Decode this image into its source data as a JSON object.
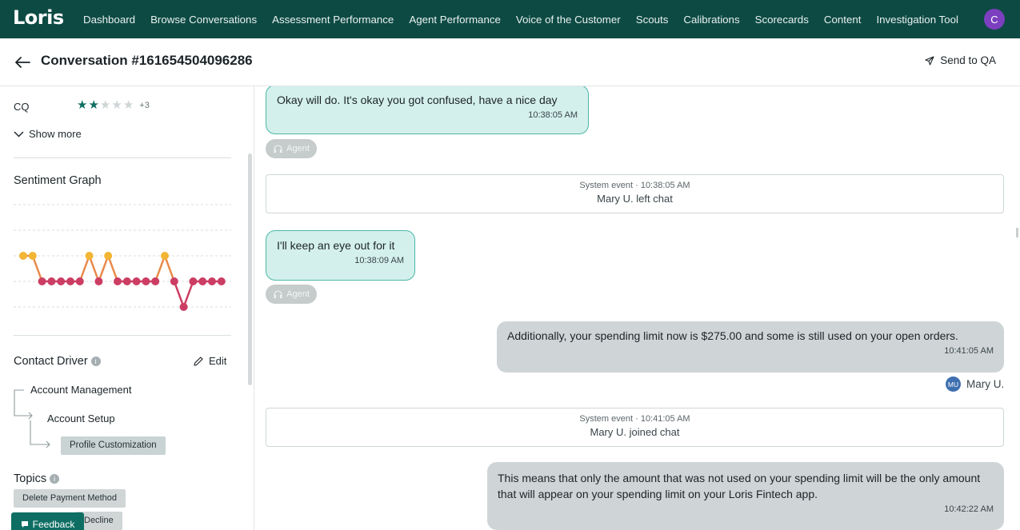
{
  "nav": {
    "logo": "Loris",
    "links": [
      "Dashboard",
      "Browse Conversations",
      "Assessment Performance",
      "Agent Performance",
      "Voice of the Customer",
      "Scouts",
      "Calibrations",
      "Scorecards",
      "Content",
      "Investigation Tool"
    ],
    "avatar": "C"
  },
  "header": {
    "title": "Conversation #161654504096286",
    "send_to_qa": "Send to QA"
  },
  "left": {
    "cq_label": "CQ",
    "cq_rating": 2,
    "cq_max": 5,
    "cq_more": "+3",
    "show_more": "Show more",
    "sentiment_title": "Sentiment Graph",
    "sentiment_points": [
      1,
      1,
      0,
      0,
      0,
      0,
      0,
      1,
      0,
      1,
      0,
      0,
      0,
      0,
      0,
      1,
      0,
      -1,
      0,
      0,
      0,
      0
    ],
    "contact_driver_title": "Contact Driver",
    "edit_label": "Edit",
    "driver_level1": "Account Management",
    "driver_level2": "Account Setup",
    "driver_level3": "Profile Customization",
    "topics_title": "Topics",
    "topic1": "Delete Payment Method",
    "topic2": "Decline",
    "feedback": "Feedback"
  },
  "chat": {
    "m1_text": "Okay will do. It's okay you got confused, have a nice day",
    "m1_time": "10:38:05 AM",
    "agent_tag": "Agent",
    "sys1_meta": "System event · 10:38:05 AM",
    "sys1_msg": "Mary U. left chat",
    "m2_text": "I'll keep an eye out for it",
    "m2_time": "10:38:09 AM",
    "m3_text": "Additionally, your spending limit now is $275.00 and some is still used on your open orders.",
    "m3_time": "10:41:05 AM",
    "customer_initials": "MU",
    "customer_name": "Mary U.",
    "sys2_meta": "System event · 10:41:05 AM",
    "sys2_msg": "Mary U. joined chat",
    "m4_text": "This means that only the amount that was not used on your spending limit will be the only amount that will appear on your spending limit on your Loris Fintech app.",
    "m4_time": "10:42:22 AM"
  }
}
